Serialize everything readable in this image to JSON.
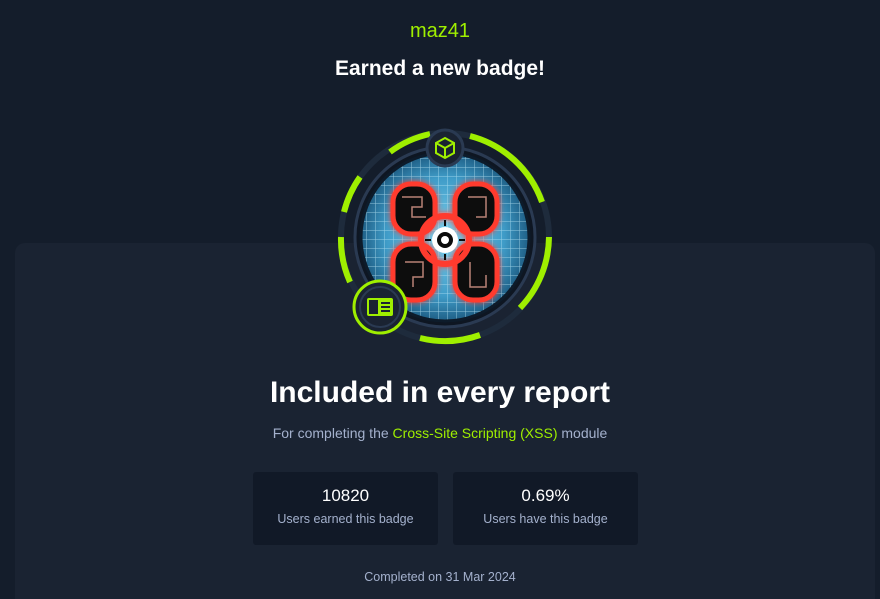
{
  "header": {
    "username": "maz41",
    "headline": "Earned a new badge!"
  },
  "badge": {
    "title": "Included in every report",
    "description_prefix": "For completing the",
    "module_name": "Cross-Site Scripting (XSS)",
    "description_suffix": "module",
    "top_icon": "cube-icon",
    "bottom_icon": "module-card-icon",
    "center_icon": "crosshair-icon"
  },
  "stats": [
    {
      "value": "10820",
      "label": "Users earned this badge"
    },
    {
      "value": "0.69%",
      "label": "Users have this badge"
    }
  ],
  "completed": "Completed on 31 Mar 2024",
  "colors": {
    "background": "#141d2b",
    "card": "#1a2332",
    "accent": "#9fef00",
    "muted_text": "#a4b1cd",
    "stat_box": "#111927",
    "badge_red": "#ff3b2f"
  }
}
